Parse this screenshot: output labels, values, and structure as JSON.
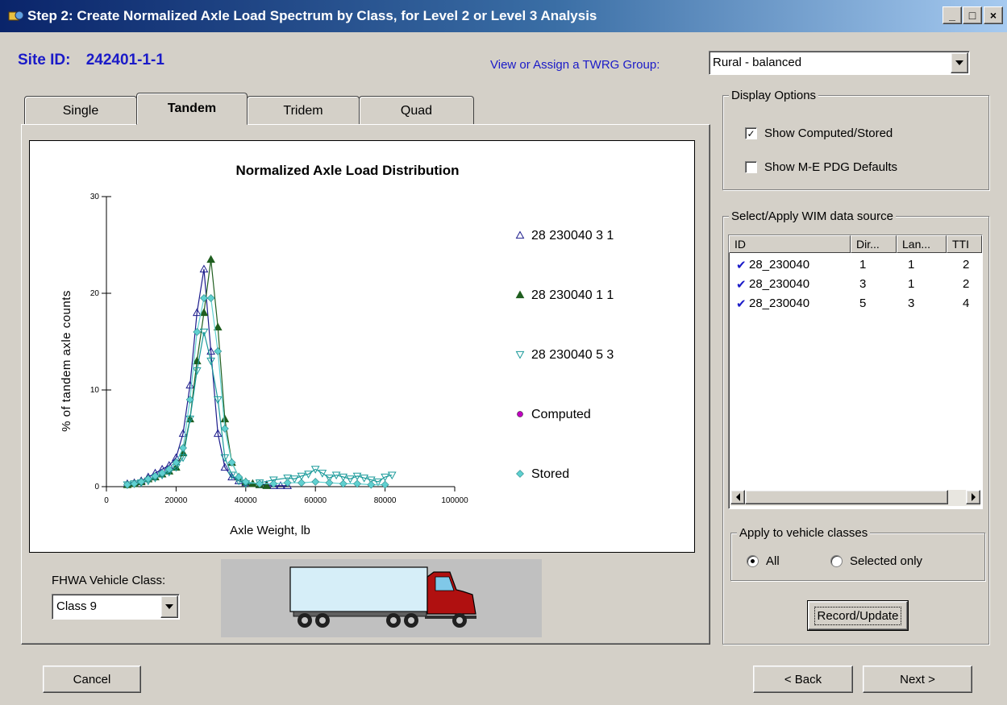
{
  "window": {
    "title": "Step 2: Create Normalized Axle Load Spectrum by Class, for Level 2 or Level 3 Analysis",
    "min_glyph": "_",
    "max_glyph": "□",
    "close_glyph": "×"
  },
  "site": {
    "label": "Site ID:",
    "value": "242401-1-1"
  },
  "twrg": {
    "label": "View or Assign a TWRG Group:",
    "value": "Rural - balanced"
  },
  "tabs": [
    {
      "label": "Single",
      "active": false
    },
    {
      "label": "Tandem",
      "active": true
    },
    {
      "label": "Tridem",
      "active": false
    },
    {
      "label": "Quad",
      "active": false
    }
  ],
  "chart_data": {
    "type": "scatter",
    "title": "Normalized Axle Load Distribution",
    "xlabel": "Axle Weight, lb",
    "ylabel": "% of tandem axle counts",
    "xlim": [
      0,
      100000
    ],
    "ylim": [
      0,
      30
    ],
    "xticks": [
      0,
      20000,
      40000,
      60000,
      80000,
      100000
    ],
    "yticks": [
      0,
      10,
      20,
      30
    ],
    "grid": false,
    "legend_position": "right",
    "series": [
      {
        "name": "28 230040 3 1",
        "marker": "triangle-up-open",
        "color": "#1c1c8c",
        "x": [
          6000,
          8000,
          10000,
          12000,
          14000,
          16000,
          18000,
          20000,
          22000,
          24000,
          26000,
          28000,
          30000,
          32000,
          34000,
          36000,
          38000,
          40000,
          42000,
          44000,
          46000,
          48000,
          50000,
          52000
        ],
        "y": [
          0.3,
          0.4,
          0.6,
          1.0,
          1.4,
          1.8,
          2.2,
          3.0,
          5.5,
          10.5,
          18.0,
          22.5,
          14.0,
          5.5,
          2.0,
          1.0,
          0.6,
          0.4,
          0.3,
          0.2,
          0.2,
          0.1,
          0.1,
          0.1
        ]
      },
      {
        "name": "28 230040 1 1",
        "marker": "triangle-up-filled",
        "color": "#1f5e1f",
        "x": [
          6000,
          8000,
          10000,
          12000,
          14000,
          16000,
          18000,
          20000,
          22000,
          24000,
          26000,
          28000,
          30000,
          32000,
          34000,
          36000,
          38000,
          40000,
          42000,
          44000,
          46000
        ],
        "y": [
          0.2,
          0.3,
          0.5,
          0.8,
          1.0,
          1.3,
          1.6,
          2.0,
          3.5,
          7.0,
          13.0,
          18.0,
          23.5,
          16.5,
          7.0,
          2.5,
          1.0,
          0.5,
          0.3,
          0.2,
          0.1
        ]
      },
      {
        "name": "28 230040 5 3",
        "marker": "triangle-down-open",
        "color": "#1a9a9a",
        "x": [
          6000,
          8000,
          10000,
          12000,
          14000,
          16000,
          18000,
          20000,
          22000,
          24000,
          26000,
          28000,
          30000,
          32000,
          34000,
          36000,
          38000,
          40000,
          44000,
          48000,
          52000,
          54000,
          56000,
          58000,
          60000,
          62000,
          64000,
          66000,
          68000,
          70000,
          72000,
          74000,
          76000,
          78000,
          80000,
          82000
        ],
        "y": [
          0.2,
          0.3,
          0.4,
          0.6,
          0.9,
          1.2,
          1.5,
          2.0,
          3.0,
          7.0,
          12.0,
          16.0,
          13.0,
          9.0,
          3.0,
          1.2,
          0.6,
          0.3,
          0.4,
          0.7,
          0.9,
          0.8,
          1.1,
          1.3,
          1.8,
          1.4,
          0.9,
          1.2,
          1.0,
          0.8,
          1.1,
          0.9,
          0.7,
          0.5,
          1.0,
          1.2
        ]
      },
      {
        "name": "Computed",
        "marker": "circle-filled",
        "color": "#c000c0",
        "x": [],
        "y": []
      },
      {
        "name": "Stored",
        "marker": "diamond-filled",
        "color": "#5fd0d0",
        "x": [
          6000,
          8000,
          10000,
          12000,
          14000,
          16000,
          18000,
          20000,
          22000,
          24000,
          26000,
          28000,
          30000,
          32000,
          34000,
          36000,
          38000,
          40000,
          44000,
          48000,
          52000,
          56000,
          60000,
          64000,
          68000,
          72000,
          76000,
          80000
        ],
        "y": [
          0.2,
          0.3,
          0.5,
          0.8,
          1.1,
          1.4,
          1.8,
          2.5,
          4.0,
          9.0,
          16.0,
          19.5,
          19.5,
          14.0,
          6.0,
          2.5,
          1.0,
          0.5,
          0.3,
          0.3,
          0.4,
          0.4,
          0.5,
          0.4,
          0.3,
          0.3,
          0.2,
          0.2
        ]
      }
    ]
  },
  "vehicle_class": {
    "label": "FHWA Vehicle Class:",
    "value": "Class 9"
  },
  "truck": {
    "cab_color": "#b01010",
    "trailer_color": "#d6eef8"
  },
  "display_options": {
    "title": "Display Options",
    "show_computed": {
      "label": "Show Computed/Stored",
      "checked": true,
      "mark": "✓"
    },
    "show_defaults": {
      "label": "Show M-E PDG Defaults",
      "checked": false,
      "mark": ""
    }
  },
  "wim": {
    "title": "Select/Apply WIM data source",
    "columns": [
      "ID",
      "Dir...",
      "Lan...",
      "TTI"
    ],
    "check_mark": "✔",
    "rows": [
      {
        "id": "28_230040",
        "dir": "1",
        "lane": "1",
        "tti": "2"
      },
      {
        "id": "28_230040",
        "dir": "3",
        "lane": "1",
        "tti": "2"
      },
      {
        "id": "28_230040",
        "dir": "5",
        "lane": "3",
        "tti": "4"
      }
    ]
  },
  "apply_classes": {
    "title": "Apply to vehicle classes",
    "all": {
      "label": "All",
      "selected": true
    },
    "selected_only": {
      "label": "Selected only",
      "selected": false
    }
  },
  "buttons": {
    "record_update": "Record/Update",
    "cancel": "Cancel",
    "back": "< Back",
    "next": "Next >"
  }
}
